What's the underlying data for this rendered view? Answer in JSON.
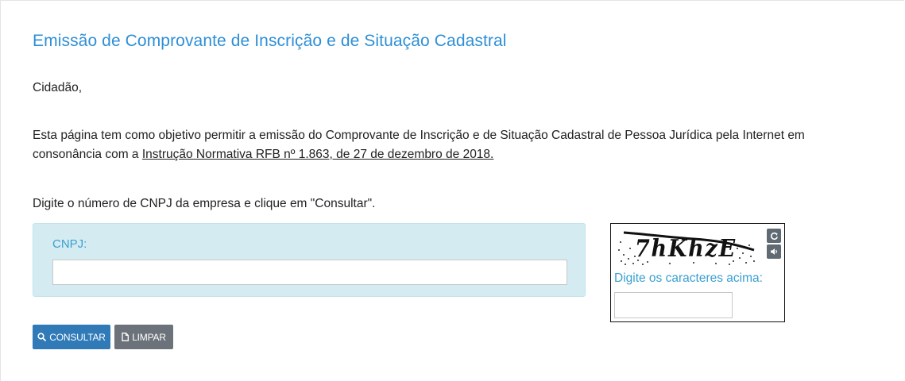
{
  "page": {
    "title": "Emissão de Comprovante de Inscrição e de Situação Cadastral",
    "greeting": "Cidadão,",
    "intro_text": "Esta página tem como objetivo permitir a emissão do Comprovante de Inscrição e de Situação Cadastral de Pessoa Jurídica pela Internet em consonância com a ",
    "intro_link": "Instrução Normativa RFB nº 1.863, de 27 de dezembro de 2018.",
    "instruction": "Digite o número de CNPJ da empresa e clique em \"Consultar\"."
  },
  "form": {
    "cnpj_label": "CNPJ:",
    "cnpj_value": "",
    "cnpj_placeholder": ""
  },
  "captcha": {
    "image_text": "7hKhzE",
    "label": "Digite os caracteres acima:",
    "value": "",
    "refresh_icon": "refresh-icon",
    "audio_icon": "audio-icon"
  },
  "buttons": {
    "consultar": "CONSULTAR",
    "limpar": "LIMPAR"
  },
  "colors": {
    "title": "#2e8fd6",
    "primary_button": "#2f7ab7",
    "secondary_button": "#6b727a",
    "cnpj_panel": "#d4ecf1"
  }
}
